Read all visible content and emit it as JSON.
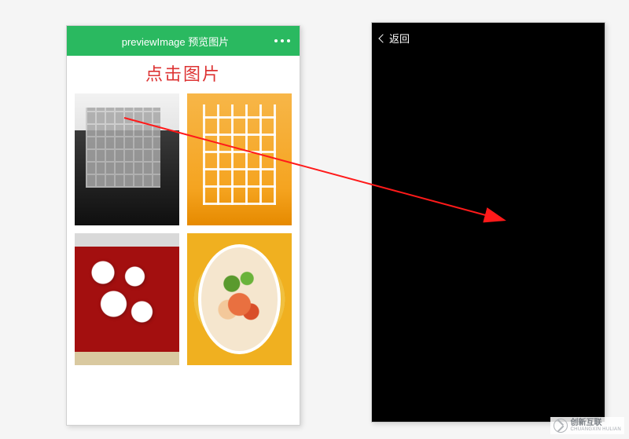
{
  "left": {
    "header_title": "previewImage 预览图片",
    "click_label": "点击图片",
    "images": [
      {
        "name": "shelf-dark-room"
      },
      {
        "name": "shelf-orange-wall"
      },
      {
        "name": "shelf-red-wall"
      },
      {
        "name": "food-plate"
      }
    ]
  },
  "right": {
    "back_label": "返回"
  },
  "watermark": {
    "brand_cn": "创新互联",
    "brand_en": "CHUANGXIN HULIAN"
  },
  "arrow": {
    "color": "#ff1a1a"
  }
}
